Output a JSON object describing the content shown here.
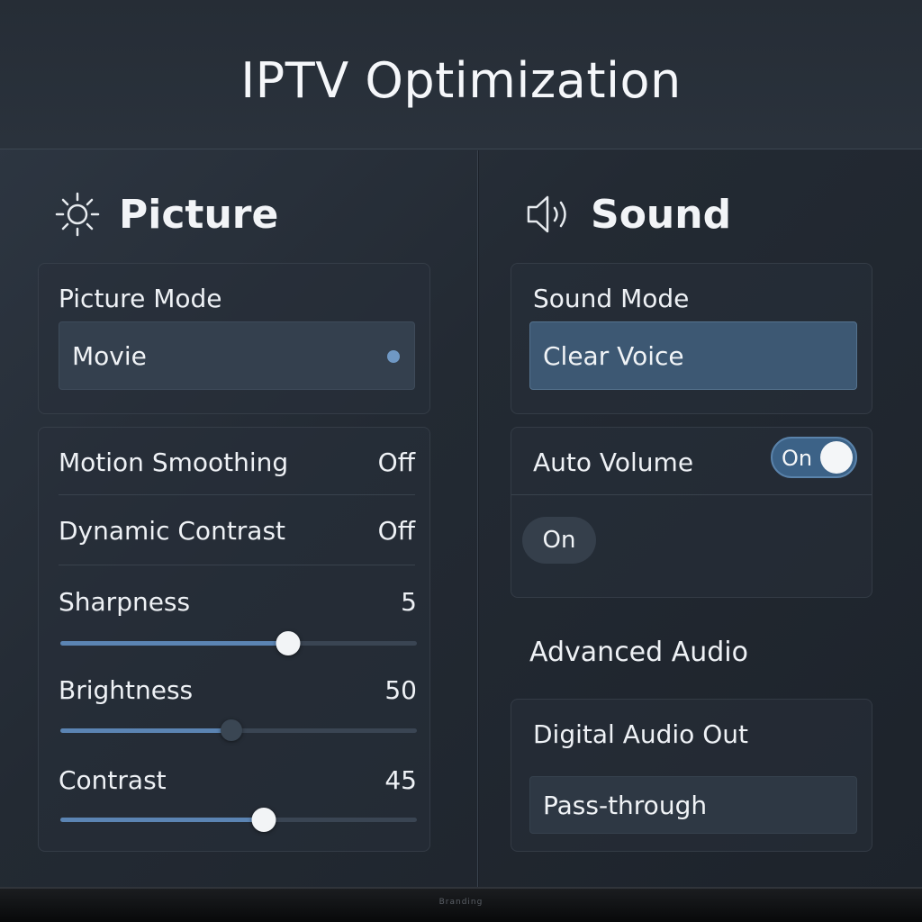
{
  "app": {
    "title": "IPTV Optimization"
  },
  "picture": {
    "heading": "Picture",
    "icon": "sun-icon",
    "mode_label": "Picture Mode",
    "mode_value": "Movie",
    "motion_smoothing": {
      "label": "Motion Smoothing",
      "value": "Off"
    },
    "dynamic_contrast": {
      "label": "Dynamic Contrast",
      "value": "Off"
    },
    "sharpness": {
      "label": "Sharpness",
      "value": "5",
      "level": 0.64
    },
    "brightness": {
      "label": "Brightness",
      "value": "50",
      "level": 0.48
    },
    "contrast": {
      "label": "Contrast",
      "value": "45",
      "level": 0.57
    }
  },
  "sound": {
    "heading": "Sound",
    "icon": "speaker-icon",
    "mode_label": "Sound Mode",
    "mode_value": "Clear Voice",
    "auto_volume": {
      "label": "Auto Volume",
      "toggle_text": "On",
      "state": true
    },
    "on_pill": "On",
    "advanced_heading": "Advanced Audio",
    "digital_out_label": "Digital Audio Out",
    "digital_out_value": "Pass-through"
  },
  "bezel": {
    "brand": "Branding"
  },
  "colors": {
    "accent": "#5b84b3",
    "toggle_on": "#3c6287",
    "selected": "#3d5873"
  }
}
